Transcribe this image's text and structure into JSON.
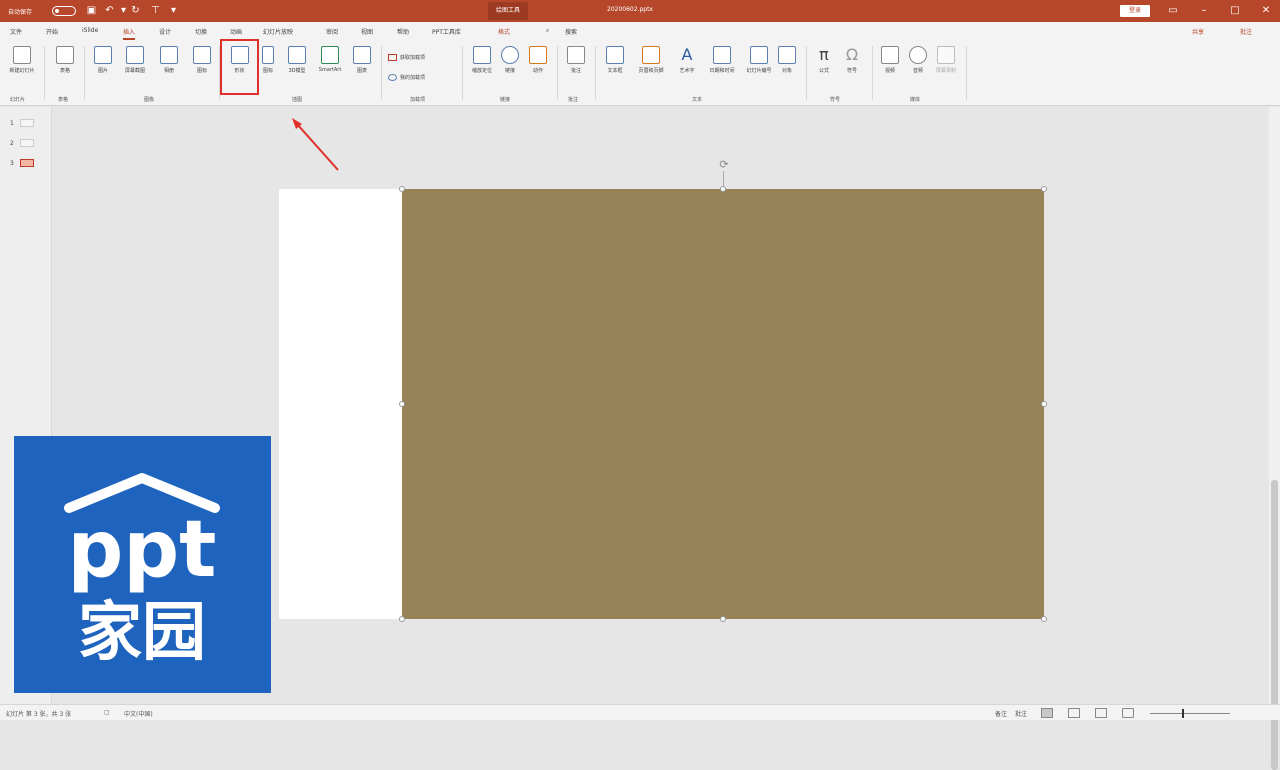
{
  "titlebar": {
    "autosave_label": "自动保存",
    "context_tab": "绘图工具",
    "doc_name": "20200602.pptx",
    "signin": "登录",
    "accent_color": "#b7472a"
  },
  "tabs": {
    "file": "文件",
    "home": "开始",
    "ilove": "iSlide",
    "insert": "插入",
    "design": "设计",
    "transitions": "切换",
    "animations": "动画",
    "slideshow": "幻灯片放映",
    "review": "审阅",
    "view": "视图",
    "help": "帮助",
    "pptools": "PPT工具库",
    "shape_format": "格式",
    "search": "搜索",
    "share": "共享",
    "comments": "批注"
  },
  "ribbon": {
    "new_slide": "新建幻灯片",
    "table": "表格",
    "pictures": "图片",
    "screenshot": "屏幕截图",
    "photo_album": "相册",
    "online_pics": "图标",
    "shapes": "形状",
    "icons": "图标",
    "models": "3D模型",
    "smartart": "SmartArt",
    "chart": "图表",
    "addin_store": "获取加载项",
    "my_addins": "我的加载项",
    "zoom": "缩放定位",
    "link": "链接",
    "action": "动作",
    "comment": "批注",
    "textbox": "文本框",
    "header_footer": "页眉和页脚",
    "wordart": "艺术字",
    "date_time": "日期和时间",
    "slide_number": "幻灯片编号",
    "object": "对象",
    "equation": "公式",
    "symbol": "符号",
    "video": "视频",
    "audio": "音频",
    "screen_rec": "屏幕录制",
    "groups": {
      "slides": "幻灯片",
      "tables": "表格",
      "images": "图像",
      "illustrations": "插图",
      "addins": "加载项",
      "links": "链接",
      "comments": "批注",
      "text": "文本",
      "symbols": "符号",
      "media": "媒体"
    }
  },
  "thumbs": [
    "1",
    "2",
    "3"
  ],
  "status": {
    "slide_info": "幻灯片 第 3 张，共 3 张",
    "language": "中文(中国)",
    "notes": "备注",
    "comments": "批注"
  },
  "logo": {
    "text_top": "ppt",
    "text_bottom": "家园",
    "color": "#1e63bd"
  },
  "shape_fill": "#978357"
}
